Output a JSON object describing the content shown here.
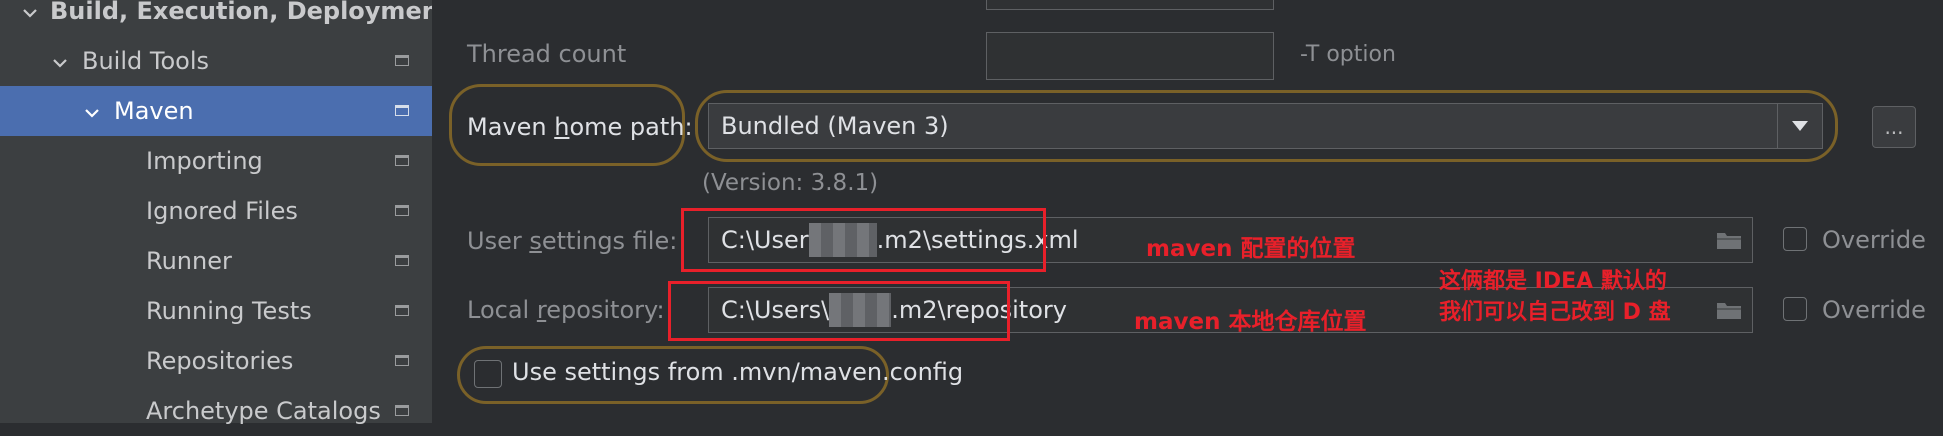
{
  "sidebar": {
    "items": [
      {
        "label": "Build, Execution, Deployment"
      },
      {
        "label": "Build Tools"
      },
      {
        "label": "Maven"
      },
      {
        "label": "Importing"
      },
      {
        "label": "Ignored Files"
      },
      {
        "label": "Runner"
      },
      {
        "label": "Running Tests"
      },
      {
        "label": "Repositories"
      },
      {
        "label": "Archetype Catalogs"
      }
    ]
  },
  "form": {
    "thread_count": {
      "label": "Thread count",
      "value": "",
      "hint": "-T option"
    },
    "maven_home": {
      "label_pre": "Maven ",
      "label_mnemonic": "h",
      "label_post": "ome path:",
      "value": "Bundled (Maven 3)",
      "version": "(Version: 3.8.1)",
      "more": "..."
    },
    "user_settings": {
      "label_pre": "User ",
      "label_mnemonic": "s",
      "label_post": "ettings file:",
      "value_pre": "C:\\User",
      "value_post": ".m2\\settings.xml",
      "override_label": "Override",
      "override_checked": false
    },
    "local_repo": {
      "label_pre": "Local ",
      "label_mnemonic": "r",
      "label_post": "epository:",
      "value_pre": "C:\\Users\\",
      "value_post": ".m2\\repository",
      "override_label": "Override",
      "override_checked": false
    },
    "use_mvn_config": {
      "label": "Use settings from .mvn/maven.config",
      "checked": false
    }
  },
  "annotations": {
    "settings_note": "maven 配置的位置",
    "repo_note": "maven 本地仓库位置",
    "default_note_line1": "这俩都是 IDEA 默认的",
    "default_note_line2": "我们可以自己改到 D 盘"
  },
  "colors": {
    "selection": "#4b6eaf",
    "highlight_outline": "#7a6128",
    "annotation_red": "#e8202a"
  }
}
